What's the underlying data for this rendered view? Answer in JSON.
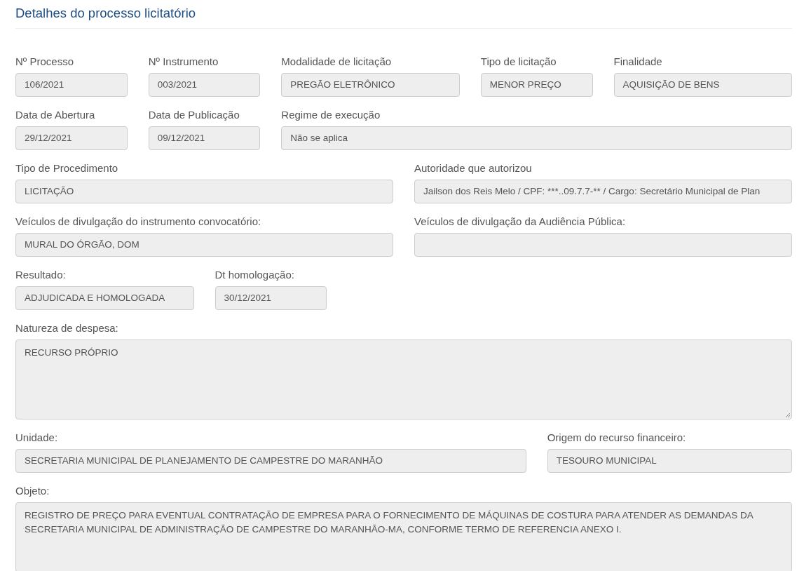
{
  "title": "Detalhes do processo licitatório",
  "rows": [
    {
      "fields": [
        {
          "label": "Nº Processo",
          "value": "106/2021",
          "kind": "input"
        },
        {
          "label": "Nº Instrumento",
          "value": "003/2021",
          "kind": "input"
        },
        {
          "label": "Modalidade de licitação",
          "value": "PREGÃO ELETRÔNICO",
          "kind": "input"
        },
        {
          "label": "Tipo de licitação",
          "value": "MENOR PREÇO",
          "kind": "input"
        },
        {
          "label": "Finalidade",
          "value": "AQUISIÇÃO DE BENS",
          "kind": "input"
        }
      ]
    },
    {
      "fields": [
        {
          "label": "Data de Abertura",
          "value": "29/12/2021",
          "kind": "input"
        },
        {
          "label": "Data de Publicação",
          "value": "09/12/2021",
          "kind": "input"
        },
        {
          "label": "Regime de execução",
          "value": "Não se aplica",
          "kind": "input"
        }
      ]
    },
    {
      "fields": [
        {
          "label": "Tipo de Procedimento",
          "value": "LICITAÇÃO",
          "kind": "input"
        },
        {
          "label": "Autoridade que autorizou",
          "value": "Jailson dos Reis Melo / CPF: ***..09.7.7-** / Cargo: Secretário Municipal de Plan",
          "kind": "input"
        }
      ]
    },
    {
      "fields": [
        {
          "label": "Veículos de divulgação do instrumento convocatório:",
          "value": "MURAL DO ÓRGÃO, DOM",
          "kind": "input"
        },
        {
          "label": "Veículos de divulgação da Audiência Pública:",
          "kind": "input"
        }
      ]
    },
    {
      "fields": [
        {
          "label": "Resultado:",
          "value": "ADJUDICADA E HOMOLOGADA",
          "kind": "input"
        },
        {
          "label": "Dt homologação:",
          "value": "30/12/2021",
          "kind": "input"
        }
      ]
    },
    {
      "fields": [
        {
          "label": "Natureza de despesa:",
          "value": "RECURSO PRÓPRIO",
          "kind": "textarea"
        }
      ]
    },
    {
      "fields": [
        {
          "label": "Unidade:",
          "value": "SECRETARIA MUNICIPAL DE PLANEJAMENTO DE CAMPESTRE DO MARANHÃO",
          "kind": "input"
        },
        {
          "label": "Origem do recurso financeiro:",
          "value": "TESOURO MUNICIPAL",
          "kind": "input"
        }
      ]
    },
    {
      "fields": [
        {
          "label": "Objeto:",
          "value": "REGISTRO DE PREÇO PARA EVENTUAL CONTRATAÇÃO DE EMPRESA PARA O FORNECIMENTO DE MÁQUINAS DE COSTURA PARA ATENDER AS DEMANDAS DA SECRETARIA MUNICIPAL DE ADMINISTRAÇÃO DE CAMPESTRE DO MARANHÃO-MA, CONFORME TERMO DE REFERENCIA ANEXO I.",
          "kind": "textarea"
        }
      ]
    }
  ]
}
